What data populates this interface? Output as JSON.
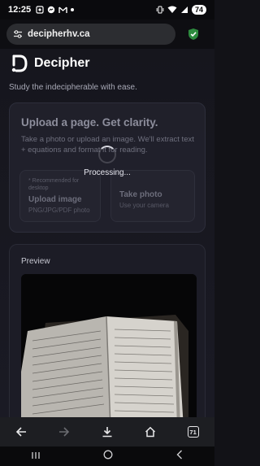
{
  "status_bar": {
    "time": "12:25",
    "battery": "74"
  },
  "browser": {
    "url": "decipherhv.ca",
    "tabs_count": "71"
  },
  "app": {
    "brand": "Decipher",
    "tagline": "Study the indecipherable with ease."
  },
  "upload": {
    "title": "Upload a page. Get clarity.",
    "description": "Take a photo or upload an image. We'll extract text + equations and format it for reading.",
    "option_upload": {
      "note": "* Recommended for desktop",
      "title": "Upload image",
      "subtitle": "PNG/JPG/PDF photo"
    },
    "option_photo": {
      "title": "Take photo",
      "subtitle": "Use your camera"
    }
  },
  "processing": {
    "text": "Processing..."
  },
  "preview": {
    "label": "Preview"
  },
  "colors": {
    "accent": "#2d8a3e",
    "background": "#121217",
    "card": "#1c1c26"
  }
}
